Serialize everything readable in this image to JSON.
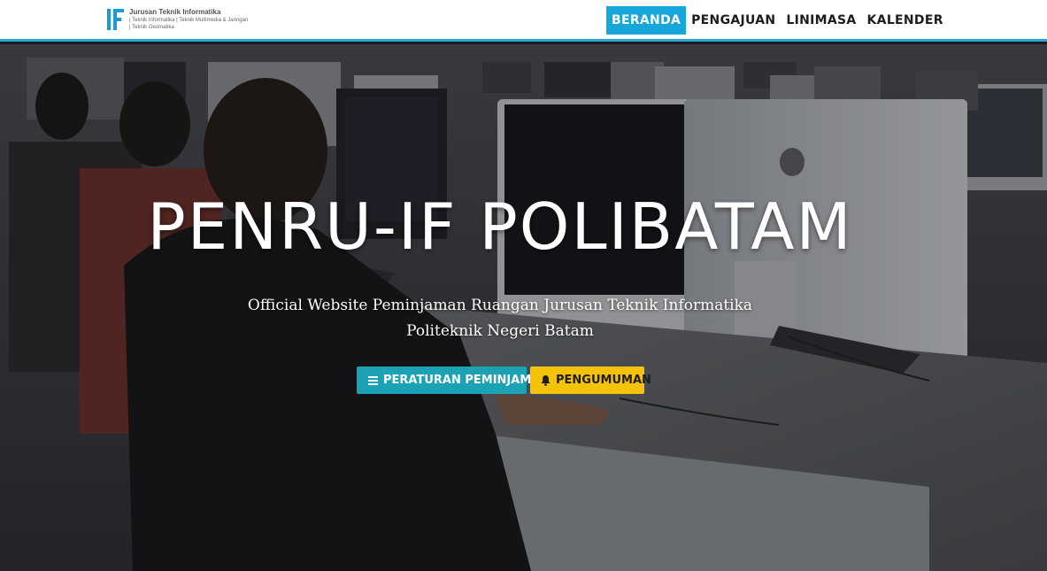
{
  "brand": {
    "logo_text": "IF",
    "title": "Jurusan Teknik Informatika",
    "line2": "| Teknik Informatika | Teknik Multimedia & Jaringan",
    "line3": "| Teknik Geomatika"
  },
  "nav": {
    "items": [
      {
        "label": "BERANDA",
        "active": true
      },
      {
        "label": "PENGAJUAN",
        "active": false
      },
      {
        "label": "LINIMASA",
        "active": false
      },
      {
        "label": "KALENDER",
        "active": false
      }
    ]
  },
  "hero": {
    "title": "PENRU-IF POLIBATAM",
    "subtitle_line1": "Official Website Peminjaman Ruangan Jurusan Teknik Informatika",
    "subtitle_line2": "Politeknik Negeri Batam",
    "buttons": [
      {
        "label": "PERATURAN PEMINJAMAN",
        "icon": "bars-icon",
        "color": "#1ba2b5"
      },
      {
        "label": "PENGUMUMAN",
        "icon": "bell-icon",
        "color": "#f5c20a"
      }
    ]
  },
  "colors": {
    "accent": "#17a6d9",
    "info": "#1ba2b5",
    "warning": "#f5c20a"
  }
}
